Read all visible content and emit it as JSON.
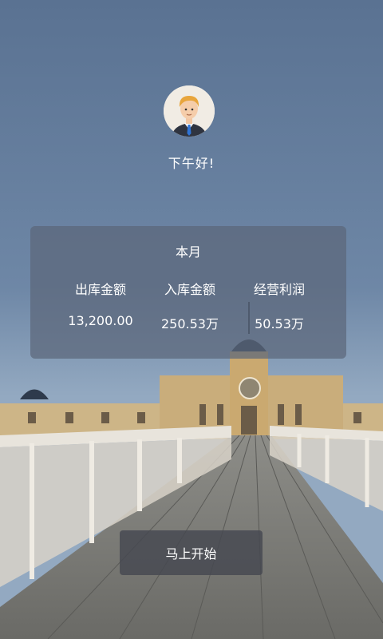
{
  "greeting": "下午好!",
  "stats": {
    "title": "本月",
    "items": [
      {
        "label": "出库金额",
        "value": "13,200.00"
      },
      {
        "label": "入库金额",
        "value": "250.53万"
      },
      {
        "label": "经营利润",
        "value": "50.53万"
      }
    ]
  },
  "start_button": "马上开始",
  "colors": {
    "sky_top": "#5b7596",
    "sky_bottom": "#8da6bf",
    "card_bg": "#5c667a",
    "button_bg": "#464850"
  },
  "icons": {
    "avatar": "businessman-avatar"
  }
}
